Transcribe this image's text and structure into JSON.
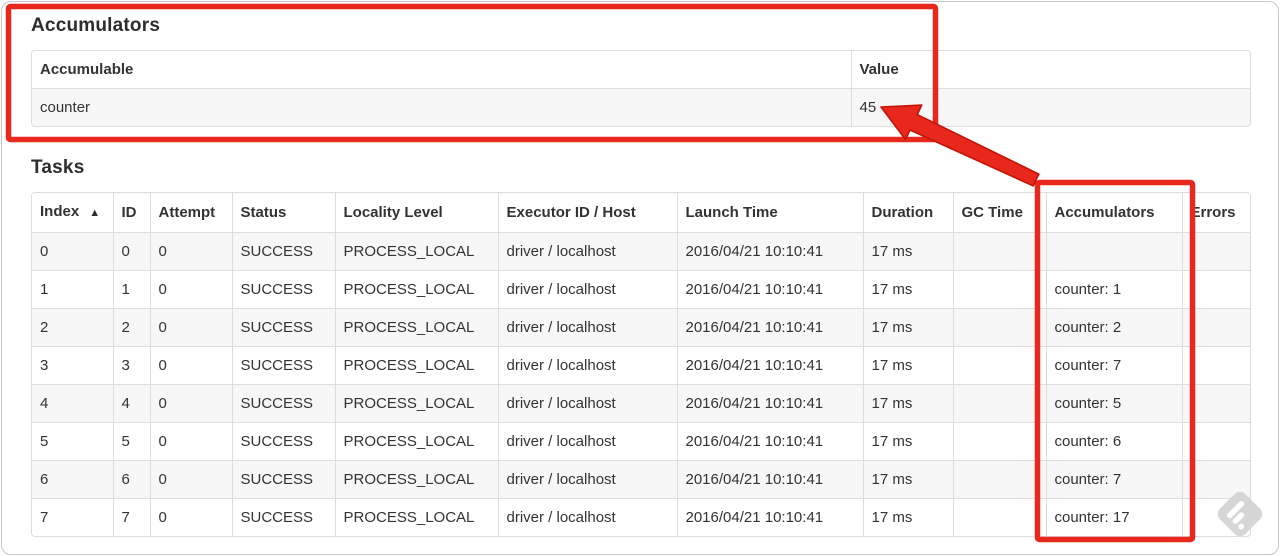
{
  "headings": {
    "accumulators": "Accumulators",
    "tasks": "Tasks"
  },
  "accumulators_table": {
    "columns": [
      "Accumulable",
      "Value"
    ],
    "row": {
      "accumulable": "counter",
      "value": "45"
    }
  },
  "tasks_table": {
    "columns": [
      "Index",
      "ID",
      "Attempt",
      "Status",
      "Locality Level",
      "Executor ID / Host",
      "Launch Time",
      "Duration",
      "GC Time",
      "Accumulators",
      "Errors"
    ],
    "sorted_column": "Index",
    "sort_icon": "▲",
    "rows": [
      [
        "0",
        "0",
        "0",
        "SUCCESS",
        "PROCESS_LOCAL",
        "driver / localhost",
        "2016/04/21 10:10:41",
        "17 ms",
        "",
        "",
        ""
      ],
      [
        "1",
        "1",
        "0",
        "SUCCESS",
        "PROCESS_LOCAL",
        "driver / localhost",
        "2016/04/21 10:10:41",
        "17 ms",
        "",
        "counter: 1",
        ""
      ],
      [
        "2",
        "2",
        "0",
        "SUCCESS",
        "PROCESS_LOCAL",
        "driver / localhost",
        "2016/04/21 10:10:41",
        "17 ms",
        "",
        "counter: 2",
        ""
      ],
      [
        "3",
        "3",
        "0",
        "SUCCESS",
        "PROCESS_LOCAL",
        "driver / localhost",
        "2016/04/21 10:10:41",
        "17 ms",
        "",
        "counter: 7",
        ""
      ],
      [
        "4",
        "4",
        "0",
        "SUCCESS",
        "PROCESS_LOCAL",
        "driver / localhost",
        "2016/04/21 10:10:41",
        "17 ms",
        "",
        "counter: 5",
        ""
      ],
      [
        "5",
        "5",
        "0",
        "SUCCESS",
        "PROCESS_LOCAL",
        "driver / localhost",
        "2016/04/21 10:10:41",
        "17 ms",
        "",
        "counter: 6",
        ""
      ],
      [
        "6",
        "6",
        "0",
        "SUCCESS",
        "PROCESS_LOCAL",
        "driver / localhost",
        "2016/04/21 10:10:41",
        "17 ms",
        "",
        "counter: 7",
        ""
      ],
      [
        "7",
        "7",
        "0",
        "SUCCESS",
        "PROCESS_LOCAL",
        "driver / localhost",
        "2016/04/21 10:10:41",
        "17 ms",
        "",
        "counter: 17",
        ""
      ]
    ]
  },
  "annotations": {
    "color": "#e8281c",
    "highlighted_value": "45",
    "boxed_regions": [
      "accumulators-section",
      "tasks-accumulators-column"
    ]
  },
  "watermark": {
    "name": "skitch-badge",
    "color": "#d2d2d2"
  },
  "colors": {
    "stripe": "#f7f7f7",
    "table_border": "#dddddd",
    "text": "#333333"
  }
}
